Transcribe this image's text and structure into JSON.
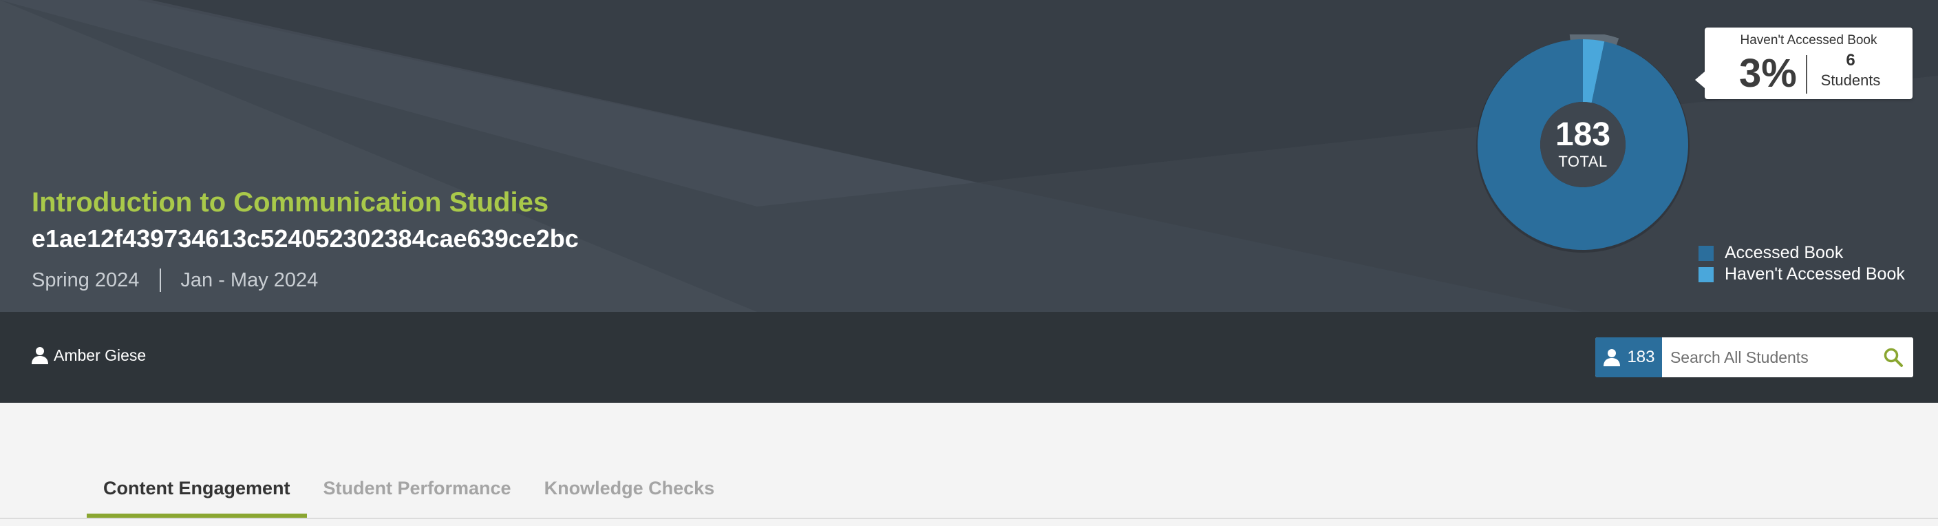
{
  "course": {
    "title": "Introduction to Communication Studies",
    "code": "e1ae12f439734613c524052302384cae639ce2bc",
    "term": "Spring 2024",
    "dates": "Jan - May 2024"
  },
  "chart_data": {
    "type": "pie",
    "categories": [
      "Accessed Book",
      "Haven't Accessed Book"
    ],
    "values": [
      177,
      6
    ],
    "colors": [
      "#2b6e9c",
      "#4aa7db"
    ],
    "center_value": "183",
    "center_label": "TOTAL",
    "legend_position": "bottom-right"
  },
  "tooltip": {
    "title": "Haven't Accessed Book",
    "percent": "3%",
    "count": "6",
    "unit": "Students"
  },
  "legend": {
    "items": [
      {
        "label": "Accessed Book",
        "color": "#2b6e9c"
      },
      {
        "label": "Haven't Accessed Book",
        "color": "#4aa7db"
      }
    ]
  },
  "user": {
    "name": "Amber Giese",
    "icon": "person-icon"
  },
  "search": {
    "student_count": "183",
    "placeholder": "Search All Students",
    "icon": "search-icon",
    "accent": "#8aa631"
  },
  "tabs": [
    {
      "label": "Content Engagement",
      "active": true
    },
    {
      "label": "Student Performance",
      "active": false
    },
    {
      "label": "Knowledge Checks",
      "active": false
    }
  ]
}
